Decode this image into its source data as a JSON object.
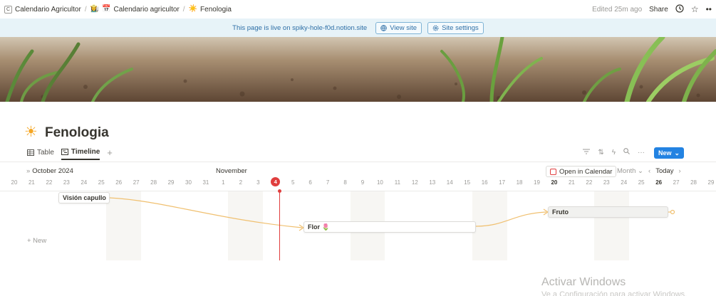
{
  "breadcrumbs": [
    {
      "icon": "C",
      "label": "Calendario Agricultor"
    },
    {
      "icon": "👩‍🌾",
      "label": ""
    },
    {
      "icon": "📅",
      "label": "Calendario agricultor"
    },
    {
      "icon": "☀️",
      "label": "Fenologia"
    }
  ],
  "topbar": {
    "edited": "Edited 25m ago",
    "share": "Share",
    "history_icon": "clock-icon",
    "favorite_icon": "star-icon",
    "more": "••"
  },
  "banner": {
    "text": "This page is live on spiky-hole-f0d.notion.site",
    "view_site": "View site",
    "site_settings": "Site settings"
  },
  "page": {
    "icon": "☀",
    "title": "Fenologia"
  },
  "tabs": [
    {
      "label": "Table",
      "icon": "table-icon",
      "active": false
    },
    {
      "label": "Timeline",
      "icon": "timeline-icon",
      "active": true
    }
  ],
  "toolbar": {
    "new_label": "New",
    "new_caret": "⌄"
  },
  "timeline": {
    "month_left": "October 2024",
    "month_mid": "November",
    "open_calendar": "Open in Calendar",
    "scale": "Month",
    "today": "Today",
    "today_day": "4",
    "days": [
      "20",
      "21",
      "22",
      "23",
      "24",
      "25",
      "26",
      "27",
      "28",
      "29",
      "30",
      "31",
      "1",
      "2",
      "3",
      "4",
      "5",
      "6",
      "7",
      "8",
      "9",
      "10",
      "11",
      "12",
      "13",
      "14",
      "15",
      "16",
      "17",
      "18",
      "19",
      "20",
      "21",
      "22",
      "23",
      "24",
      "25",
      "26",
      "27",
      "28",
      "29"
    ],
    "items": [
      {
        "label": "Visión capullo"
      },
      {
        "label": "Flor 🌷"
      },
      {
        "label": "Fruto"
      }
    ],
    "new_label": "+ New"
  },
  "watermark": {
    "title": "Activar Windows",
    "subtitle": "Ve a Configuración para activar Windows."
  },
  "colors": {
    "accent": "#2383e2",
    "today": "#e03e3e",
    "dependency": "#f0c070",
    "banner_bg": "#e7f3f8"
  }
}
